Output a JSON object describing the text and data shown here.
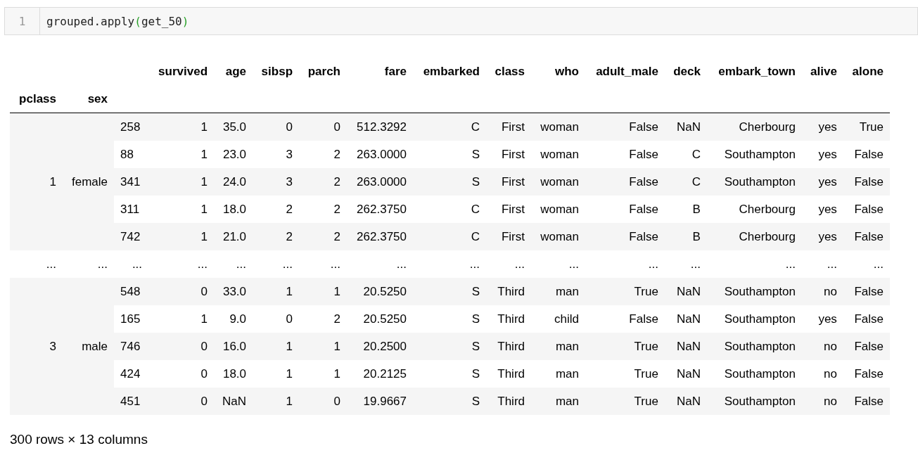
{
  "code_cell": {
    "line_number": "1",
    "tokens": [
      {
        "text": "grouped.apply",
        "kind": "plain"
      },
      {
        "text": "(",
        "kind": "bracket"
      },
      {
        "text": "get_50",
        "kind": "plain"
      },
      {
        "text": ")",
        "kind": "bracket"
      }
    ]
  },
  "table": {
    "columns": [
      "survived",
      "age",
      "sibsp",
      "parch",
      "fare",
      "embarked",
      "class",
      "who",
      "adult_male",
      "deck",
      "embark_town",
      "alive",
      "alone"
    ],
    "index_names": [
      "pclass",
      "sex"
    ],
    "groups": [
      {
        "kind": "data",
        "pclass": "1",
        "sex": "female",
        "rows": [
          {
            "index": "258",
            "values": [
              "1",
              "35.0",
              "0",
              "0",
              "512.3292",
              "C",
              "First",
              "woman",
              "False",
              "NaN",
              "Cherbourg",
              "yes",
              "True"
            ]
          },
          {
            "index": "88",
            "values": [
              "1",
              "23.0",
              "3",
              "2",
              "263.0000",
              "S",
              "First",
              "woman",
              "False",
              "C",
              "Southampton",
              "yes",
              "False"
            ]
          },
          {
            "index": "341",
            "values": [
              "1",
              "24.0",
              "3",
              "2",
              "263.0000",
              "S",
              "First",
              "woman",
              "False",
              "C",
              "Southampton",
              "yes",
              "False"
            ]
          },
          {
            "index": "311",
            "values": [
              "1",
              "18.0",
              "2",
              "2",
              "262.3750",
              "C",
              "First",
              "woman",
              "False",
              "B",
              "Cherbourg",
              "yes",
              "False"
            ]
          },
          {
            "index": "742",
            "values": [
              "1",
              "21.0",
              "2",
              "2",
              "262.3750",
              "C",
              "First",
              "woman",
              "False",
              "B",
              "Cherbourg",
              "yes",
              "False"
            ]
          }
        ]
      },
      {
        "kind": "ellipsis",
        "cells": [
          "...",
          "...",
          "...",
          "...",
          "...",
          "...",
          "...",
          "...",
          "...",
          "...",
          "...",
          "...",
          "...",
          "...",
          "...",
          "..."
        ]
      },
      {
        "kind": "data",
        "pclass": "3",
        "sex": "male",
        "rows": [
          {
            "index": "548",
            "values": [
              "0",
              "33.0",
              "1",
              "1",
              "20.5250",
              "S",
              "Third",
              "man",
              "True",
              "NaN",
              "Southampton",
              "no",
              "False"
            ]
          },
          {
            "index": "165",
            "values": [
              "1",
              "9.0",
              "0",
              "2",
              "20.5250",
              "S",
              "Third",
              "child",
              "False",
              "NaN",
              "Southampton",
              "yes",
              "False"
            ]
          },
          {
            "index": "746",
            "values": [
              "0",
              "16.0",
              "1",
              "1",
              "20.2500",
              "S",
              "Third",
              "man",
              "True",
              "NaN",
              "Southampton",
              "no",
              "False"
            ]
          },
          {
            "index": "424",
            "values": [
              "0",
              "18.0",
              "1",
              "1",
              "20.2125",
              "S",
              "Third",
              "man",
              "True",
              "NaN",
              "Southampton",
              "no",
              "False"
            ]
          },
          {
            "index": "451",
            "values": [
              "0",
              "NaN",
              "1",
              "0",
              "19.9667",
              "S",
              "Third",
              "man",
              "True",
              "NaN",
              "Southampton",
              "no",
              "False"
            ]
          }
        ]
      }
    ]
  },
  "footer": "300 rows × 13 columns"
}
